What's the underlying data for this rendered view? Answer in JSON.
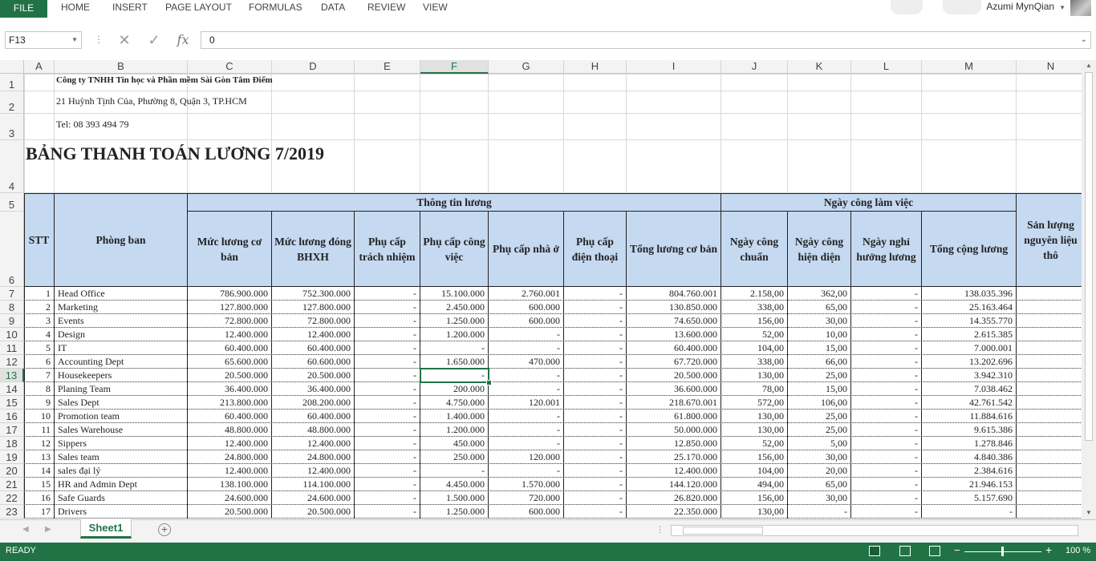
{
  "ribbon": {
    "file": "FILE",
    "tabs": [
      "HOME",
      "INSERT",
      "PAGE LAYOUT",
      "FORMULAS",
      "DATA",
      "REVIEW",
      "VIEW"
    ],
    "user": "Azumi MynQian"
  },
  "formula_bar": {
    "name_box": "F13",
    "value": "0",
    "fx": "fx"
  },
  "columns": [
    "A",
    "B",
    "C",
    "D",
    "E",
    "F",
    "G",
    "H",
    "I",
    "J",
    "K",
    "L",
    "M",
    "N"
  ],
  "selected_column": "F",
  "selected_row": 13,
  "sheet": {
    "company": "Công ty TNHH Tin học và Phần mềm Sài Gòn Tâm Điểm",
    "address": "21 Huỳnh Tịnh Của, Phường 8, Quận 3, TP.HCM",
    "phone": "Tel: 08 393 494 79",
    "title": "BẢNG THANH TOÁN LƯƠNG 7/2019",
    "group_salary_info": "Thông tin lương",
    "group_workdays": "Ngày công làm việc",
    "headers": {
      "stt": "STT",
      "dept": "Phòng ban",
      "base_salary": "Mức lương cơ bản",
      "insurance_salary": "Mức lương đóng BHXH",
      "resp_allowance": "Phụ cấp trách nhiệm",
      "job_allowance": "Phụ cấp công việc",
      "house_allowance": "Phụ cấp nhà ở",
      "phone_allowance": "Phụ cấp điện thoại",
      "total_base": "Tổng lương cơ bản",
      "std_days": "Ngày công chuẩn",
      "actual_days": "Ngày công hiện diện",
      "paid_leave": "Ngày nghỉ hưởng lương",
      "total_salary": "Tổng cộng lương",
      "output": "Sản lượng nguyên liệu thô"
    },
    "rows": [
      {
        "stt": "1",
        "dept": "Head Office",
        "c": "786.900.000",
        "d": "752.300.000",
        "e": "-",
        "f": "15.100.000",
        "g": "2.760.001",
        "h": "-",
        "i": "804.760.001",
        "j": "2.158,00",
        "k": "362,00",
        "l": "-",
        "m": "138.035.396"
      },
      {
        "stt": "2",
        "dept": "Marketing",
        "c": "127.800.000",
        "d": "127.800.000",
        "e": "-",
        "f": "2.450.000",
        "g": "600.000",
        "h": "-",
        "i": "130.850.000",
        "j": "338,00",
        "k": "65,00",
        "l": "-",
        "m": "25.163.464"
      },
      {
        "stt": "3",
        "dept": "Events",
        "c": "72.800.000",
        "d": "72.800.000",
        "e": "-",
        "f": "1.250.000",
        "g": "600.000",
        "h": "-",
        "i": "74.650.000",
        "j": "156,00",
        "k": "30,00",
        "l": "-",
        "m": "14.355.770"
      },
      {
        "stt": "4",
        "dept": "Design",
        "c": "12.400.000",
        "d": "12.400.000",
        "e": "-",
        "f": "1.200.000",
        "g": "-",
        "h": "-",
        "i": "13.600.000",
        "j": "52,00",
        "k": "10,00",
        "l": "-",
        "m": "2.615.385"
      },
      {
        "stt": "5",
        "dept": "IT",
        "c": "60.400.000",
        "d": "60.400.000",
        "e": "-",
        "f": "-",
        "g": "-",
        "h": "-",
        "i": "60.400.000",
        "j": "104,00",
        "k": "15,00",
        "l": "-",
        "m": "7.000.001"
      },
      {
        "stt": "6",
        "dept": "Accounting Dept",
        "c": "65.600.000",
        "d": "60.600.000",
        "e": "-",
        "f": "1.650.000",
        "g": "470.000",
        "h": "-",
        "i": "67.720.000",
        "j": "338,00",
        "k": "66,00",
        "l": "-",
        "m": "13.202.696"
      },
      {
        "stt": "7",
        "dept": "Housekeepers",
        "c": "20.500.000",
        "d": "20.500.000",
        "e": "-",
        "f": "-",
        "g": "-",
        "h": "-",
        "i": "20.500.000",
        "j": "130,00",
        "k": "25,00",
        "l": "-",
        "m": "3.942.310"
      },
      {
        "stt": "8",
        "dept": "Planing Team",
        "c": "36.400.000",
        "d": "36.400.000",
        "e": "-",
        "f": "200.000",
        "g": "-",
        "h": "-",
        "i": "36.600.000",
        "j": "78,00",
        "k": "15,00",
        "l": "-",
        "m": "7.038.462"
      },
      {
        "stt": "9",
        "dept": "Sales Dept",
        "c": "213.800.000",
        "d": "208.200.000",
        "e": "-",
        "f": "4.750.000",
        "g": "120.001",
        "h": "-",
        "i": "218.670.001",
        "j": "572,00",
        "k": "106,00",
        "l": "-",
        "m": "42.761.542"
      },
      {
        "stt": "10",
        "dept": "Promotion team",
        "c": "60.400.000",
        "d": "60.400.000",
        "e": "-",
        "f": "1.400.000",
        "g": "-",
        "h": "-",
        "i": "61.800.000",
        "j": "130,00",
        "k": "25,00",
        "l": "-",
        "m": "11.884.616"
      },
      {
        "stt": "11",
        "dept": "Sales Warehouse",
        "c": "48.800.000",
        "d": "48.800.000",
        "e": "-",
        "f": "1.200.000",
        "g": "-",
        "h": "-",
        "i": "50.000.000",
        "j": "130,00",
        "k": "25,00",
        "l": "-",
        "m": "9.615.386"
      },
      {
        "stt": "12",
        "dept": "Sippers",
        "c": "12.400.000",
        "d": "12.400.000",
        "e": "-",
        "f": "450.000",
        "g": "-",
        "h": "-",
        "i": "12.850.000",
        "j": "52,00",
        "k": "5,00",
        "l": "-",
        "m": "1.278.846"
      },
      {
        "stt": "13",
        "dept": "Sales team",
        "c": "24.800.000",
        "d": "24.800.000",
        "e": "-",
        "f": "250.000",
        "g": "120.000",
        "h": "-",
        "i": "25.170.000",
        "j": "156,00",
        "k": "30,00",
        "l": "-",
        "m": "4.840.386"
      },
      {
        "stt": "14",
        "dept": "sales đại lý",
        "c": "12.400.000",
        "d": "12.400.000",
        "e": "-",
        "f": "-",
        "g": "-",
        "h": "-",
        "i": "12.400.000",
        "j": "104,00",
        "k": "20,00",
        "l": "-",
        "m": "2.384.616"
      },
      {
        "stt": "15",
        "dept": "HR and Admin Dept",
        "c": "138.100.000",
        "d": "114.100.000",
        "e": "-",
        "f": "4.450.000",
        "g": "1.570.000",
        "h": "-",
        "i": "144.120.000",
        "j": "494,00",
        "k": "65,00",
        "l": "-",
        "m": "21.946.153"
      },
      {
        "stt": "16",
        "dept": "Safe Guards",
        "c": "24.600.000",
        "d": "24.600.000",
        "e": "-",
        "f": "1.500.000",
        "g": "720.000",
        "h": "-",
        "i": "26.820.000",
        "j": "156,00",
        "k": "30,00",
        "l": "-",
        "m": "5.157.690"
      },
      {
        "stt": "17",
        "dept": "Drivers",
        "c": "20.500.000",
        "d": "20.500.000",
        "e": "-",
        "f": "1.250.000",
        "g": "600.000",
        "h": "-",
        "i": "22.350.000",
        "j": "130,00",
        "k": "-",
        "l": "-",
        "m": "-"
      }
    ]
  },
  "sheet_tabs": [
    "Sheet1"
  ],
  "status": {
    "mode": "READY",
    "zoom": "100 %"
  },
  "colors": {
    "accent": "#217346",
    "header_fill": "#c5d9f1"
  }
}
